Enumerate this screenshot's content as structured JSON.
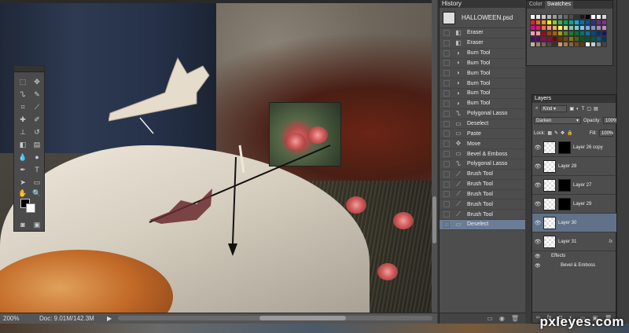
{
  "history": {
    "title": "History",
    "snapshot_label": "HALLOWEEN.psd",
    "rows": [
      {
        "label": "Eraser",
        "icon": "eraser-icon"
      },
      {
        "label": "Eraser",
        "icon": "eraser-icon"
      },
      {
        "label": "Burn Tool",
        "icon": "burn-icon"
      },
      {
        "label": "Burn Tool",
        "icon": "burn-icon"
      },
      {
        "label": "Burn Tool",
        "icon": "burn-icon"
      },
      {
        "label": "Burn Tool",
        "icon": "burn-icon"
      },
      {
        "label": "Burn Tool",
        "icon": "burn-icon"
      },
      {
        "label": "Burn Tool",
        "icon": "burn-icon"
      },
      {
        "label": "Polygonal Lasso",
        "icon": "lasso-icon"
      },
      {
        "label": "Deselect",
        "icon": "document-icon"
      },
      {
        "label": "Paste",
        "icon": "document-icon"
      },
      {
        "label": "Move",
        "icon": "move-icon"
      },
      {
        "label": "Bevel & Emboss",
        "icon": "document-icon"
      },
      {
        "label": "Polygonal Lasso",
        "icon": "lasso-icon"
      },
      {
        "label": "Brush Tool",
        "icon": "brush-icon"
      },
      {
        "label": "Brush Tool",
        "icon": "brush-icon"
      },
      {
        "label": "Brush Tool",
        "icon": "brush-icon"
      },
      {
        "label": "Brush Tool",
        "icon": "brush-icon"
      },
      {
        "label": "Brush Tool",
        "icon": "brush-icon"
      },
      {
        "label": "Deselect",
        "icon": "document-icon",
        "selected": true
      }
    ]
  },
  "swatches": {
    "tabs": [
      "Color",
      "Swatches"
    ],
    "active_tab": "Swatches",
    "colors": [
      "#ffffff",
      "#e6e6e6",
      "#cccccc",
      "#b3b3b3",
      "#999999",
      "#808080",
      "#666666",
      "#4d4d4d",
      "#333333",
      "#1a1a1a",
      "#000000",
      "#ffffff",
      "#f0f0f0",
      "#d9d9d9",
      "#ed1c24",
      "#f26522",
      "#f7941d",
      "#fff200",
      "#8dc63f",
      "#39b54a",
      "#00a651",
      "#00a99d",
      "#00aeef",
      "#0072bc",
      "#0054a6",
      "#2e3192",
      "#662d91",
      "#92278f",
      "#ec008c",
      "#ed145b",
      "#f26c4f",
      "#f69679",
      "#fbaf5d",
      "#fff568",
      "#c4df9b",
      "#82ca9c",
      "#7accc8",
      "#6dcff6",
      "#7da7d9",
      "#8393ca",
      "#a187be",
      "#bc8dbf",
      "#f49ac2",
      "#f6989d",
      "#9e0b0f",
      "#a0410d",
      "#a3620a",
      "#aba000",
      "#598527",
      "#197b30",
      "#007236",
      "#00746b",
      "#0076a3",
      "#004a80",
      "#003471",
      "#1b1464",
      "#440e62",
      "#630460",
      "#9e005d",
      "#9e0039",
      "#790000",
      "#7b2e00",
      "#7d4900",
      "#827b00",
      "#406618",
      "#005e20",
      "#005826",
      "#005952",
      "#005b7f",
      "#003663",
      "#c7b299",
      "#998675",
      "#736357",
      "#534741",
      "#37302d",
      "#c69c6d",
      "#a67c52",
      "#8c6239",
      "#754c24",
      "#603913",
      "#ffffff",
      "#cccccc",
      "#888888",
      "#444444"
    ]
  },
  "layers": {
    "title": "Layers",
    "filter_label": "Kind",
    "blend_mode": "Darken",
    "opacity_label": "Opacity:",
    "opacity_value": "100%",
    "lock_label": "Lock:",
    "fill_label": "Fill:",
    "fill_value": "100%",
    "items": [
      {
        "name": "Layer 26 copy",
        "mask": true
      },
      {
        "name": "Layer 28",
        "mask": false
      },
      {
        "name": "Layer 27",
        "mask": true
      },
      {
        "name": "Layer 29",
        "mask": true
      },
      {
        "name": "Layer 30",
        "mask": false,
        "selected": true
      },
      {
        "name": "Layer 31",
        "mask": false,
        "fx": "fx"
      }
    ],
    "effects_label": "Effects",
    "effect_name": "Bevel & Emboss"
  },
  "status": {
    "zoom": "200%",
    "doc": "Doc: 9.01M/142.3M"
  },
  "watermark": "pxleyes.com"
}
